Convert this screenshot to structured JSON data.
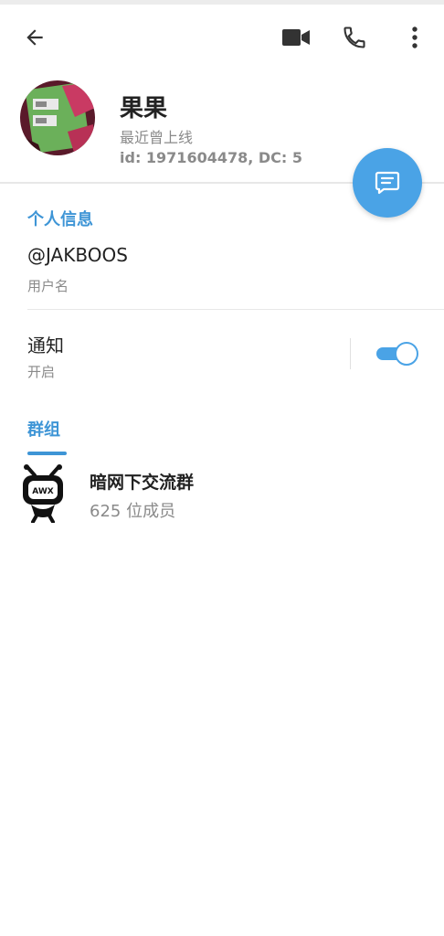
{
  "profile": {
    "name": "果果",
    "status": "最近曾上线",
    "id_line": "id: 1971604478, DC: 5"
  },
  "sections": {
    "personal_info": "个人信息",
    "groups": "群组"
  },
  "username": {
    "value": "@JAKBOOS",
    "label": "用户名"
  },
  "notifications": {
    "label": "通知",
    "value": "开启",
    "enabled": true
  },
  "group": {
    "name": "暗网下交流群",
    "members": "625 位成员",
    "avatar_text": "AWX"
  },
  "icons": {
    "back": "arrow-left-icon",
    "video": "video-camera-icon",
    "phone": "phone-icon",
    "more": "more-vertical-icon",
    "fab": "message-icon"
  },
  "colors": {
    "accent": "#4aa3e6",
    "section_title": "#3e95d6",
    "secondary_text": "#8a8a8a"
  }
}
